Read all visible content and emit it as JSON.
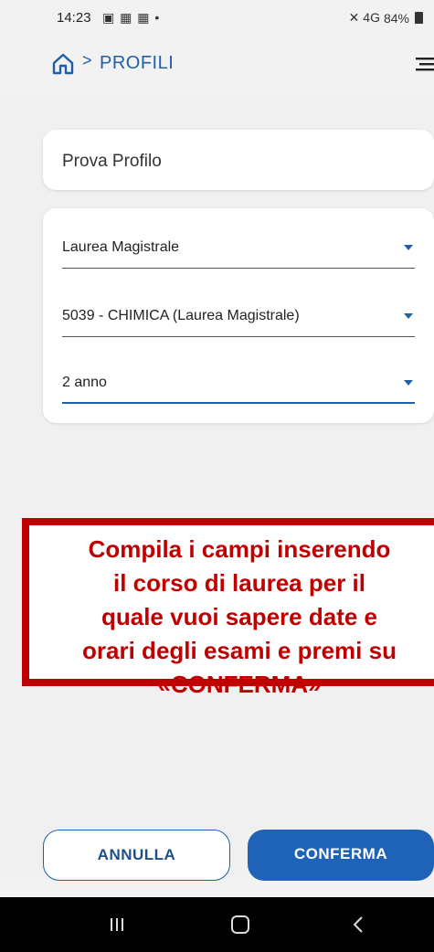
{
  "status_bar": {
    "time": "14:23",
    "notification_icons": "▣ ▦ ▦ •",
    "signal_text": "✕ 4G",
    "battery_percent": "84%"
  },
  "header": {
    "breadcrumb_separator": ">",
    "title": "PROFILI"
  },
  "profile": {
    "name": "Prova Profilo"
  },
  "selects": [
    {
      "value": "Laurea Magistrale"
    },
    {
      "value": "5039 - CHIMICA (Laurea Magistrale)"
    },
    {
      "value": "2 anno"
    }
  ],
  "callout": {
    "text": "Compila i campi inserendo\nil corso di laurea per il\nquale vuoi sapere date e\norari degli esami e premi su\n«CONFERMA»"
  },
  "actions": {
    "cancel_label": "ANNULLA",
    "confirm_label": "CONFERMA"
  },
  "colors": {
    "accent": "#1f63b8",
    "callout_red": "#c00000"
  }
}
